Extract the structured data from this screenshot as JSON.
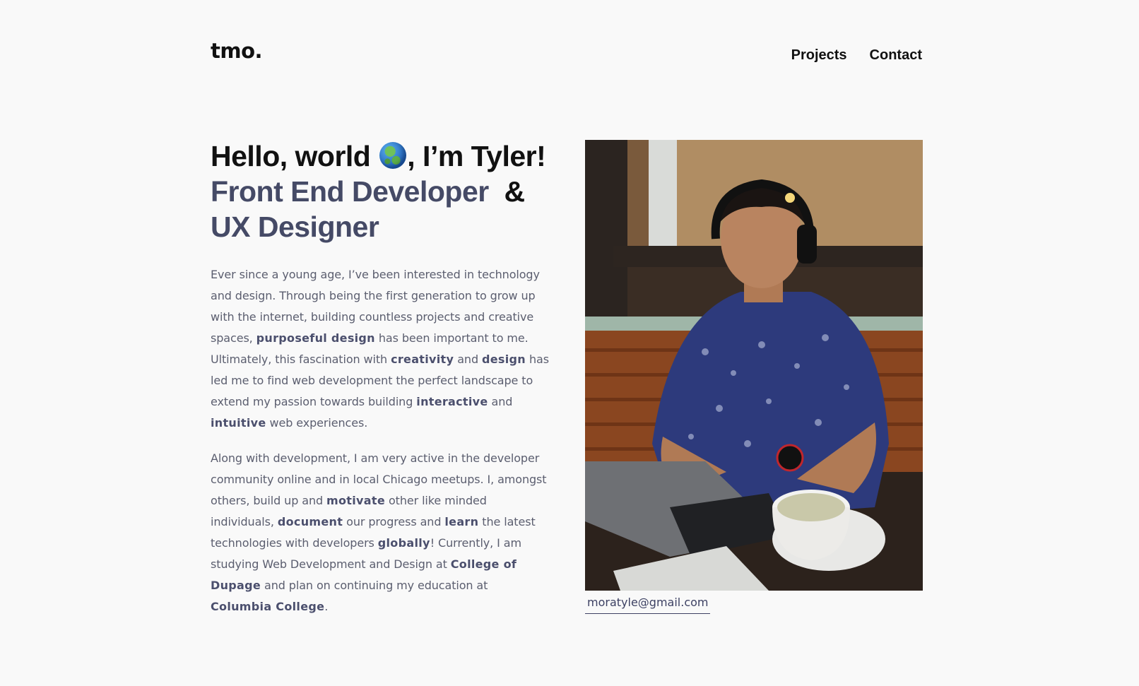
{
  "header": {
    "logo": "tmo.",
    "nav": [
      {
        "label": "Projects"
      },
      {
        "label": "Contact"
      }
    ]
  },
  "intro": {
    "greeting_before_emoji": "Hello, world",
    "greeting_after_emoji": ", I’m Tyler!",
    "role_line1": "Front End Developer",
    "ampersand": "&",
    "role_line2": "UX Designer",
    "paragraph1": [
      {
        "text": "Ever since a young age, I’ve been interested in technology and design. Through being the first generation to grow up with the internet, building countless projects and creative spaces, ",
        "bold": false
      },
      {
        "text": "purposeful design",
        "bold": true
      },
      {
        "text": " has been important to me. Ultimately, this fascination with ",
        "bold": false
      },
      {
        "text": "creativity",
        "bold": true
      },
      {
        "text": " and ",
        "bold": false
      },
      {
        "text": "design",
        "bold": true
      },
      {
        "text": " has led me to find web development the perfect landscape to extend my passion towards building ",
        "bold": false
      },
      {
        "text": "interactive",
        "bold": true
      },
      {
        "text": " and ",
        "bold": false
      },
      {
        "text": "intuitive",
        "bold": true
      },
      {
        "text": " web experiences.",
        "bold": false
      }
    ],
    "paragraph2": [
      {
        "text": "Along with development, I am very active in the developer community online and in local Chicago meetups. I, amongst others, build up and ",
        "bold": false
      },
      {
        "text": "motivate",
        "bold": true
      },
      {
        "text": " other like minded individuals, ",
        "bold": false
      },
      {
        "text": "document",
        "bold": true
      },
      {
        "text": " our progress and ",
        "bold": false
      },
      {
        "text": "learn",
        "bold": true
      },
      {
        "text": " the latest technologies with developers ",
        "bold": false
      },
      {
        "text": "globally",
        "bold": true
      },
      {
        "text": "! Currently, I am studying Web Development and Design at ",
        "bold": false
      },
      {
        "text": "College of Dupage",
        "bold": true
      },
      {
        "text": " and plan on continuing my education at ",
        "bold": false
      },
      {
        "text": "Columbia College",
        "bold": true
      },
      {
        "text": ".",
        "bold": false
      }
    ]
  },
  "profile": {
    "photo_icon": "profile-photo",
    "email": "moratyle@gmail.com"
  },
  "colors": {
    "background": "#f9f9f9",
    "accent": "#454a66",
    "body_text": "#5b5e6f"
  }
}
